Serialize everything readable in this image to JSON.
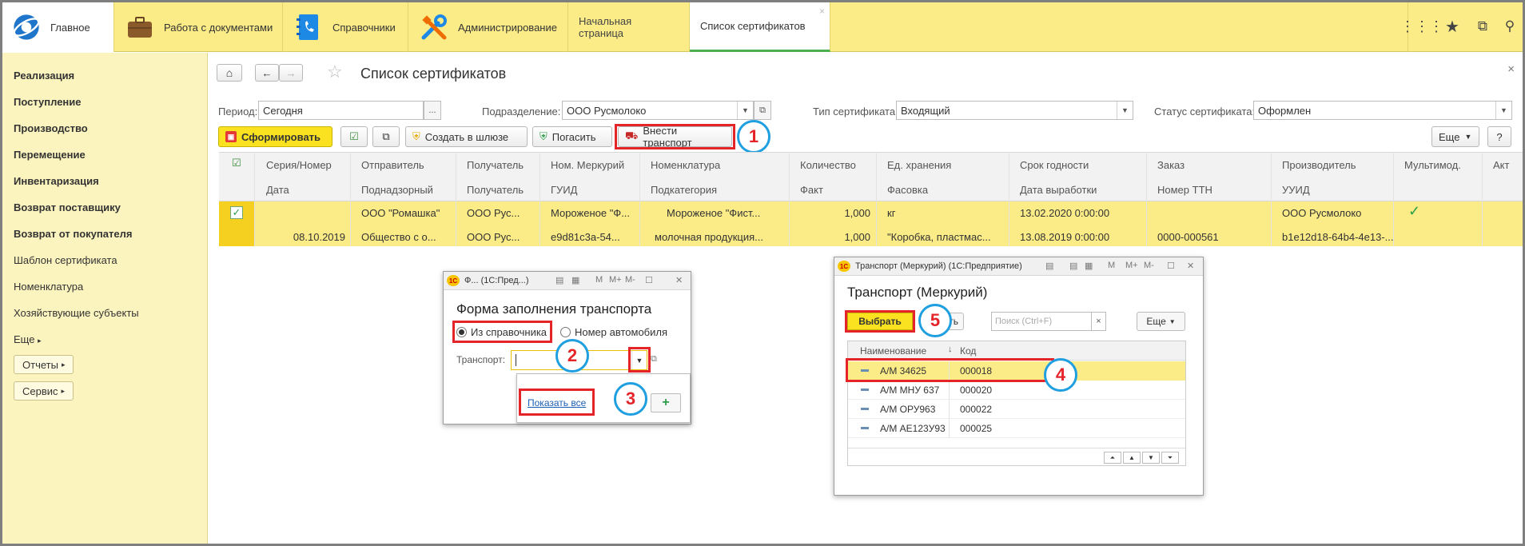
{
  "sections": [
    "Главное",
    "Работа с документами",
    "Справочники",
    "Администрирование"
  ],
  "tabs": {
    "home": "Начальная страница",
    "certs": "Список сертификатов",
    "close": "×"
  },
  "sidebar": {
    "bold": [
      "Реализация",
      "Поступление",
      "Производство",
      "Перемещение",
      "Инвентаризация",
      "Возврат поставщику",
      "Возврат от покупателя"
    ],
    "normal": [
      "Шаблон сертификата",
      "Номенклатура",
      "Хозяйствующие субъекты"
    ],
    "more": "Еще",
    "reports": "Отчеты",
    "service": "Сервис"
  },
  "page": {
    "title": "Список сертификатов",
    "close": "×"
  },
  "filters": {
    "period_label": "Период:",
    "period_value": "Сегодня",
    "dept_label": "Подразделение:",
    "dept_value": "ООО Русмолоко",
    "type_label": "Тип сертификата:",
    "type_value": "Входящий",
    "status_label": "Статус сертификата:",
    "status_value": "Оформлен"
  },
  "toolbar": {
    "form": "Сформировать",
    "gateway": "Создать в шлюзе",
    "redeem": "Погасить",
    "transport": "Внести транспорт",
    "more": "Еще",
    "help": "?"
  },
  "columns": {
    "top": [
      "Серия/Номер",
      "Отправитель",
      "Получатель",
      "Ном. Меркурий",
      "Номенклатура",
      "Количество",
      "Ед. хранения",
      "Срок годности",
      "Заказ",
      "Производитель",
      "Мультимод.",
      "Акт"
    ],
    "bottom": [
      "Дата",
      "Поднадзорный",
      "Получатель",
      "ГУИД",
      "Подкатегория",
      "Факт",
      "Фасовка",
      "Дата выработки",
      "Номер ТТН",
      "УУИД"
    ]
  },
  "row": {
    "top": [
      "",
      "ООО \"Ромашка\"",
      "ООО Рус...",
      "Мороженое \"Ф...",
      "Мороженое \"Фист...",
      "1,000",
      "кг",
      "13.02.2020 0:00:00",
      "",
      "ООО Русмолоко"
    ],
    "bottom": [
      "08.10.2019",
      "Общество с о...",
      "ООО Рус...",
      "e9d81c3a-54...",
      "молочная продукция...",
      "1,000",
      "\"Коробка, пластмас...",
      "13.08.2019 0:00:00",
      "0000-000561",
      "b1e12d18-64b4-4e13-..."
    ],
    "multimod": "✓"
  },
  "popup1": {
    "title": "Ф...  (1С:Пред...)",
    "heading": "Форма заполнения транспорта",
    "opt1": "Из справочника",
    "opt2": "Номер автомобиля",
    "transport_label": "Транспорт:",
    "show_all": "Показать все"
  },
  "popup2": {
    "title": "Транспорт (Меркурий)  (1С:Предприятие)",
    "heading": "Транспорт (Меркурий)",
    "select": "Выбрать",
    "create_partial": "дать",
    "search_placeholder": "Поиск (Ctrl+F)",
    "more": "Еще",
    "col_name": "Наименование",
    "col_code": "Код",
    "rows": [
      {
        "name": "А/М 34625",
        "code": "000018"
      },
      {
        "name": "А/М МНУ 637",
        "code": "000020"
      },
      {
        "name": "А/М ОРУ963",
        "code": "000022"
      },
      {
        "name": "А/М АЕ123У93",
        "code": "000025"
      }
    ]
  },
  "steps": [
    "1",
    "2",
    "3",
    "4",
    "5"
  ],
  "colors": {
    "accent": "#fbec88",
    "red": "#e5242a",
    "blue": "#1f9fe0",
    "green": "#4caf50"
  }
}
